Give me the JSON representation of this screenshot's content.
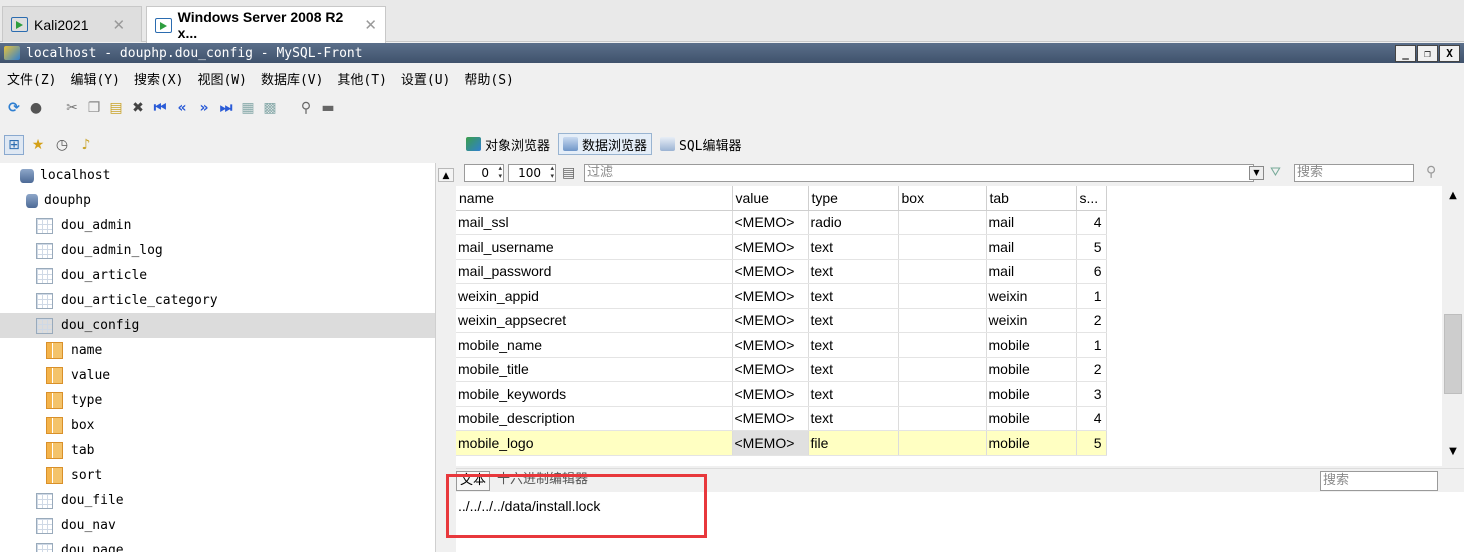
{
  "vm_tabs": [
    {
      "label": "Kali2021",
      "active": false
    },
    {
      "label": "Windows Server 2008 R2 x...",
      "active": true
    }
  ],
  "window": {
    "title": "localhost - douphp.dou_config - MySQL-Front",
    "buttons": [
      "_",
      "❐",
      "X"
    ]
  },
  "menu": [
    "文件(Z)",
    "编辑(Y)",
    "搜索(X)",
    "视图(W)",
    "数据库(V)",
    "其他(T)",
    "设置(U)",
    "帮助(S)"
  ],
  "view_tabs": [
    "对象浏览器",
    "数据浏览器",
    "SQL编辑器"
  ],
  "tree": {
    "server": "localhost",
    "database": "douphp",
    "tables": [
      "dou_admin",
      "dou_admin_log",
      "dou_article",
      "dou_article_category",
      "dou_config"
    ],
    "columns": [
      "name",
      "value",
      "type",
      "box",
      "tab",
      "sort"
    ],
    "tables_after": [
      "dou_file",
      "dou_nav",
      "dou_page"
    ],
    "selected": "dou_config"
  },
  "filter": {
    "offset": "0",
    "limit": "100",
    "placeholder": "过滤",
    "search_placeholder": "搜索"
  },
  "grid": {
    "headers": [
      "name",
      "value",
      "type",
      "box",
      "tab",
      "s..."
    ],
    "rows": [
      [
        "mail_ssl",
        "<MEMO>",
        "radio",
        "",
        "mail",
        "4"
      ],
      [
        "mail_username",
        "<MEMO>",
        "text",
        "",
        "mail",
        "5"
      ],
      [
        "mail_password",
        "<MEMO>",
        "text",
        "",
        "mail",
        "6"
      ],
      [
        "weixin_appid",
        "<MEMO>",
        "text",
        "",
        "weixin",
        "1"
      ],
      [
        "weixin_appsecret",
        "<MEMO>",
        "text",
        "",
        "weixin",
        "2"
      ],
      [
        "mobile_name",
        "<MEMO>",
        "text",
        "",
        "mobile",
        "1"
      ],
      [
        "mobile_title",
        "<MEMO>",
        "text",
        "",
        "mobile",
        "2"
      ],
      [
        "mobile_keywords",
        "<MEMO>",
        "text",
        "",
        "mobile",
        "3"
      ],
      [
        "mobile_description",
        "<MEMO>",
        "text",
        "",
        "mobile",
        "4"
      ],
      [
        "mobile_logo",
        "<MEMO>",
        "file",
        "",
        "mobile",
        "5"
      ]
    ],
    "selected_row": 9
  },
  "editor": {
    "tabs": [
      "文本",
      "十六进制编辑器"
    ],
    "search_placeholder": "搜索",
    "value": "../../../../data/install.lock"
  },
  "colors": {
    "highlight_box": "#e8383c",
    "selected_row": "#ffffc2",
    "titlebar": "#4a5d78"
  }
}
